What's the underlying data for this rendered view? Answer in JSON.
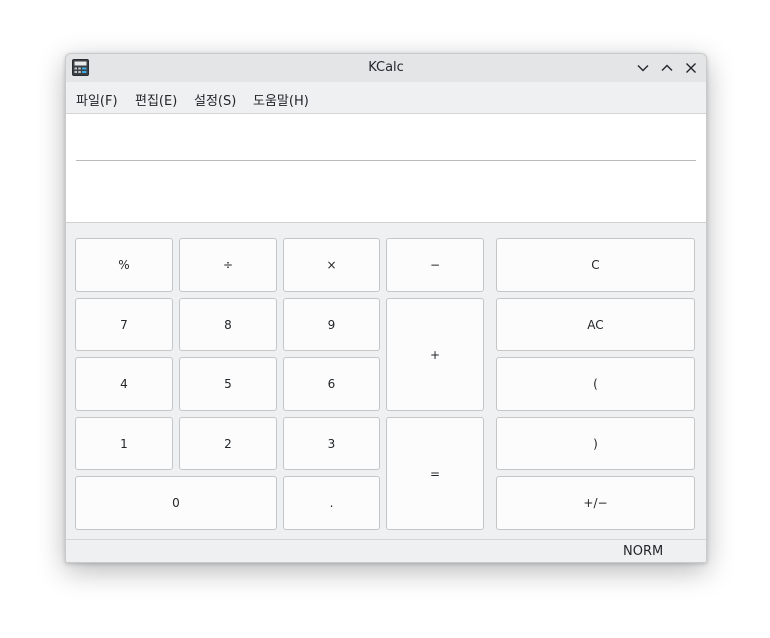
{
  "window": {
    "title": "KCalc",
    "controls": {
      "minimize": "minimize",
      "maximize": "maximize",
      "close": "close"
    }
  },
  "menu": [
    {
      "label": "파일(F)"
    },
    {
      "label": "편집(E)"
    },
    {
      "label": "설정(S)"
    },
    {
      "label": "도움말(H)"
    }
  ],
  "display": {
    "upper": "",
    "lower": ""
  },
  "keys": {
    "percent": "%",
    "divide": "÷",
    "multiply": "×",
    "minus": "−",
    "clear": "C",
    "seven": "7",
    "eight": "8",
    "nine": "9",
    "plus": "+",
    "all_clear": "AC",
    "four": "4",
    "five": "5",
    "six": "6",
    "open_paren": "(",
    "one": "1",
    "two": "2",
    "three": "3",
    "equals": "=",
    "close_paren": ")",
    "zero": "0",
    "decimal": ".",
    "sign": "+/−"
  },
  "status": {
    "mode": "NORM"
  },
  "icons": {
    "app": "calculator-icon",
    "minimize": "chevron-down-icon",
    "maximize": "chevron-up-icon",
    "close": "close-icon"
  }
}
